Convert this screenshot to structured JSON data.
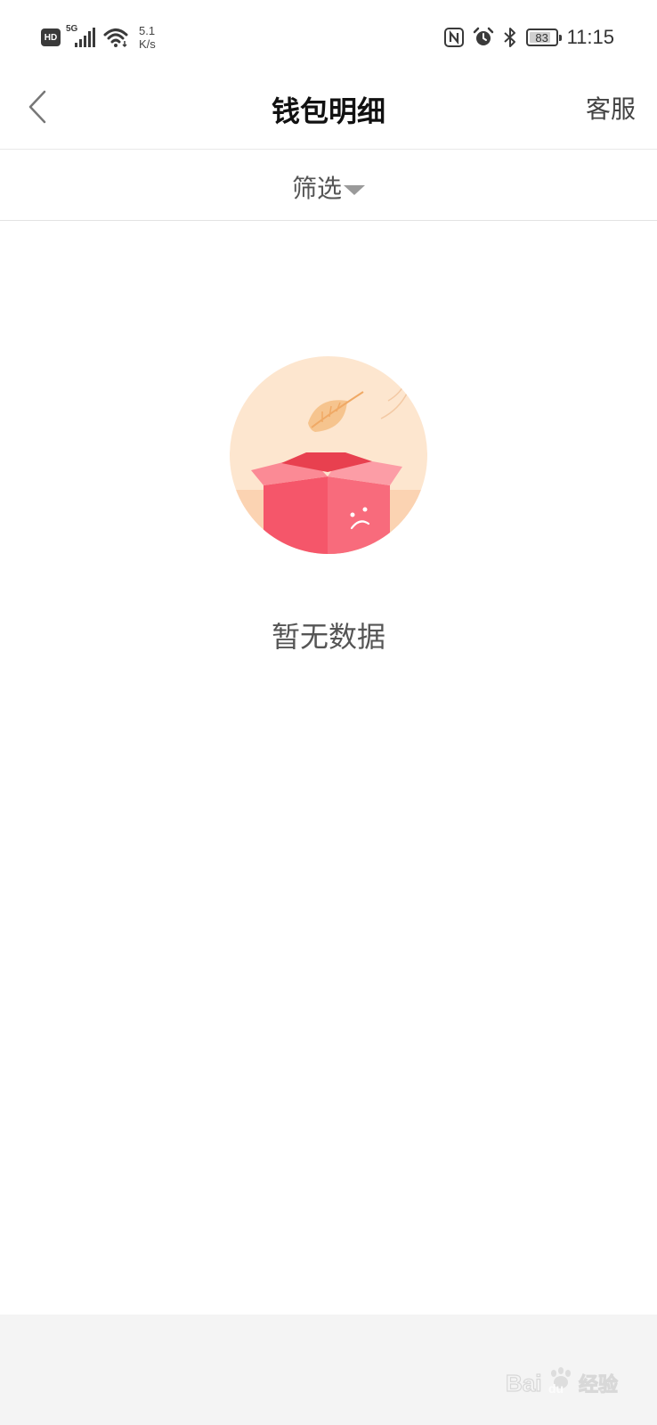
{
  "status_bar": {
    "hd": "HD",
    "network": "5G",
    "speed_value": "5.1",
    "speed_unit": "K/s",
    "battery": "83",
    "battery_level": 0.83,
    "time": "11:15",
    "icons": [
      "nfc-icon",
      "alarm-icon",
      "bluetooth-icon"
    ]
  },
  "nav": {
    "title": "钱包明细",
    "service": "客服"
  },
  "filter": {
    "label": "筛选"
  },
  "empty": {
    "text": "暂无数据"
  },
  "colors": {
    "illustration_bg": "#fde6cf",
    "box_red": "#f5566a",
    "box_light": "#fb8a95",
    "leaf": "#f6c48e"
  }
}
